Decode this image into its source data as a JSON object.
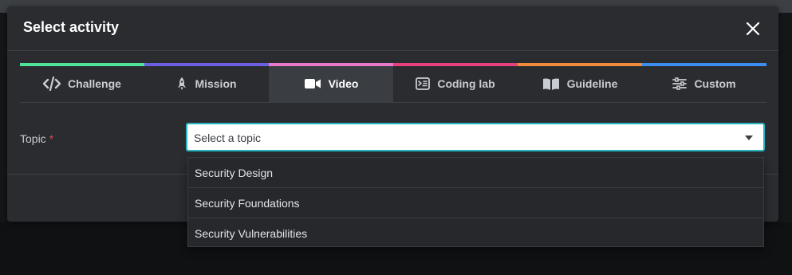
{
  "modal": {
    "title": "Select activity"
  },
  "tabs": [
    {
      "label": "Challenge",
      "icon": "code-icon",
      "color": "#4fe39a"
    },
    {
      "label": "Mission",
      "icon": "rocket-icon",
      "color": "#6b5fe0"
    },
    {
      "label": "Video",
      "icon": "video-camera-icon",
      "color": "#e879c6",
      "active": true
    },
    {
      "label": "Coding lab",
      "icon": "coding-lab-icon",
      "color": "#e8407a"
    },
    {
      "label": "Guideline",
      "icon": "book-icon",
      "color": "#f08a3c"
    },
    {
      "label": "Custom",
      "icon": "sliders-icon",
      "color": "#3a8ef0"
    }
  ],
  "form": {
    "topic_label": "Topic",
    "required_mark": "*",
    "topic_placeholder": "Select a topic",
    "options": [
      "Security Design",
      "Security Foundations",
      "Security Vulnerabilities"
    ]
  },
  "colors": {
    "accent": "#26b5c1",
    "required": "#e0455b"
  }
}
